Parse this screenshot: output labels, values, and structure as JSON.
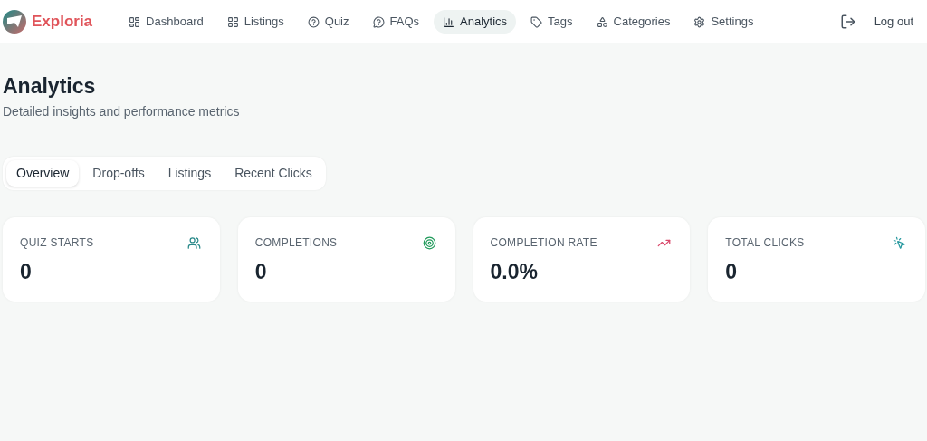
{
  "brand": "Exploria",
  "nav": [
    {
      "label": "Dashboard",
      "selected": false
    },
    {
      "label": "Listings",
      "selected": false
    },
    {
      "label": "Quiz",
      "selected": false
    },
    {
      "label": "FAQs",
      "selected": false
    },
    {
      "label": "Analytics",
      "selected": true
    },
    {
      "label": "Tags",
      "selected": false
    },
    {
      "label": "Categories",
      "selected": false
    },
    {
      "label": "Settings",
      "selected": false
    }
  ],
  "logout": "Log out",
  "page": {
    "title": "Analytics",
    "subtitle": "Detailed insights and performance metrics"
  },
  "tabs": [
    {
      "label": "Overview",
      "selected": true
    },
    {
      "label": "Drop-offs",
      "selected": false
    },
    {
      "label": "Listings",
      "selected": false
    },
    {
      "label": "Recent Clicks",
      "selected": false
    }
  ],
  "stats": [
    {
      "label": "QUIZ STARTS",
      "value": "0"
    },
    {
      "label": "COMPLETIONS",
      "value": "0"
    },
    {
      "label": "COMPLETION RATE",
      "value": "0.0%"
    },
    {
      "label": "TOTAL CLICKS",
      "value": "0"
    }
  ]
}
